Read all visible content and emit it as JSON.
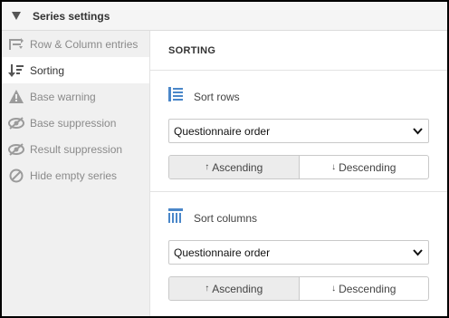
{
  "header": {
    "title": "Series settings",
    "caret_icon": "triangle-down-icon"
  },
  "sidebar": {
    "items": [
      {
        "label": "Row & Column entries",
        "icon": "row-column-icon"
      },
      {
        "label": "Sorting",
        "icon": "sort-icon",
        "active": true
      },
      {
        "label": "Base warning",
        "icon": "warning-icon"
      },
      {
        "label": "Base suppression",
        "icon": "eye-slash-icon"
      },
      {
        "label": "Result suppression",
        "icon": "eye-slash-icon"
      },
      {
        "label": "Hide empty series",
        "icon": "ban-icon"
      }
    ]
  },
  "main": {
    "section_title": "SORTING",
    "sort_rows": {
      "label": "Sort rows",
      "select_value": "Questionnaire order",
      "ascending_label": "Ascending",
      "descending_label": "Descending",
      "selected": "Ascending"
    },
    "sort_columns": {
      "label": "Sort columns",
      "select_value": "Questionnaire order",
      "ascending_label": "Ascending",
      "descending_label": "Descending",
      "selected": "Ascending"
    }
  },
  "colors": {
    "accent_icon": "#4a87c9",
    "muted_icon": "#9b9b9b",
    "active_bg": "#ececec"
  }
}
